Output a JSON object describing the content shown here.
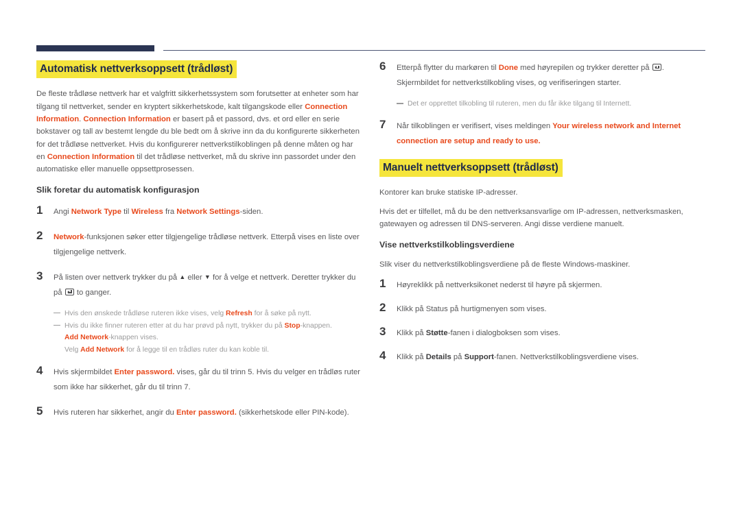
{
  "left": {
    "section_title": "Automatisk nettverksoppsett (trådløst)",
    "intro": {
      "p1_a": "De fleste trådløse nettverk har et valgfritt sikkerhetssystem som forutsetter at enheter som har tilgang til nettverket, sender en kryptert sikkerhetskode, kalt tilgangskode eller ",
      "p1_b": "Connection Information",
      "p1_c": ". ",
      "p1_d": "Connection Information",
      "p1_e": " er basert på et passord, dvs. et ord eller en serie bokstaver og tall av bestemt lengde du ble bedt om å skrive inn da du konfigurerte sikkerheten for det trådløse nettverket. Hvis du konfigurerer nettverkstilkoblingen på denne måten og har en ",
      "p1_f": "Connection Information",
      "p1_g": " til det trådløse nettverket, må du skrive inn passordet under den automatiske eller manuelle oppsettprosessen."
    },
    "sub_head": "Slik foretar du automatisk konfigurasjon",
    "step1": {
      "num": "1",
      "a": "Angi ",
      "b": "Network Type",
      "c": " til ",
      "d": "Wireless",
      "e": " fra ",
      "f": "Network Settings",
      "g": "-siden."
    },
    "step2": {
      "num": "2",
      "a": "Network",
      "b": "-funksjonen søker etter tilgjengelige trådløse nettverk. Etterpå vises en liste over tilgjengelige nettverk."
    },
    "step3": {
      "num": "3",
      "a": "På listen over nettverk trykker du på ",
      "tri_up": "▲",
      "b": " eller ",
      "tri_down": "▼",
      "c": " for å velge et nettverk. Deretter trykker du på ",
      "d": " to ganger."
    },
    "notes3": {
      "n1_a": "Hvis den ønskede trådløse ruteren ikke vises, velg ",
      "n1_b": "Refresh",
      "n1_c": " for å søke på nytt.",
      "n2_a": "Hvis du ikke finner ruteren etter at du har prøvd på nytt, trykker du på ",
      "n2_b": "Stop",
      "n2_c": "-knappen.",
      "n2_cont1_a": "Add Network",
      "n2_cont1_b": "-knappen vises.",
      "n2_cont2_a": "Velg ",
      "n2_cont2_b": "Add Network",
      "n2_cont2_c": " for å legge til en trådløs ruter du kan koble til."
    },
    "step4": {
      "num": "4",
      "a": "Hvis skjermbildet ",
      "b": "Enter password.",
      "c": " vises, går du til trinn 5. Hvis du velger en trådløs ruter som ikke har sikkerhet, går du til trinn 7."
    },
    "step5": {
      "num": "5",
      "a": "Hvis ruteren har sikkerhet, angir du ",
      "b": "Enter password.",
      "c": " (sikkerhetskode eller PIN-kode)."
    }
  },
  "right": {
    "step6": {
      "num": "6",
      "a": "Etterpå flytter du markøren til ",
      "b": "Done",
      "c": " med høyrepilen og trykker deretter på ",
      "d": ". Skjermbildet for nettverkstilkobling vises, og verifiseringen starter."
    },
    "note6": "Det er opprettet tilkobling til ruteren, men du får ikke tilgang til Internett.",
    "step7": {
      "num": "7",
      "a": "Når tilkoblingen er verifisert, vises meldingen ",
      "b": "Your wireless network and Internet connection are setup and ready to use."
    },
    "section_title": "Manuelt nettverksoppsett (trådløst)",
    "p1": "Kontorer kan bruke statiske IP-adresser.",
    "p2": "Hvis det er tilfellet, må du be den nettverksansvarlige om IP-adressen, nettverksmasken, gatewayen og adressen til DNS-serveren. Angi disse verdiene manuelt.",
    "sub_head": "Vise nettverkstilkoblingsverdiene",
    "p3": "Slik viser du nettverkstilkoblingsverdiene på de fleste Windows-maskiner.",
    "step1": {
      "num": "1",
      "a": "Høyreklikk på nettverksikonet nederst til høyre på skjermen."
    },
    "step2": {
      "num": "2",
      "a": "Klikk på Status på hurtigmenyen som vises."
    },
    "step3": {
      "num": "3",
      "a": "Klikk på ",
      "b": "Støtte",
      "c": "-fanen i dialogboksen som vises."
    },
    "step4": {
      "num": "4",
      "a": "Klikk på ",
      "b": "Details",
      "c": " på ",
      "d": "Support",
      "e": "-fanen. Nettverkstilkoblingsverdiene vises."
    }
  },
  "colors": {
    "rule_bar": "#2b3553",
    "rule_line": "#4c5573",
    "highlight": "#f5e53c",
    "heading_text": "#1f2a4a",
    "accent": "#e8491c",
    "body_text": "#58585a",
    "note_text": "#9b9b9c"
  }
}
